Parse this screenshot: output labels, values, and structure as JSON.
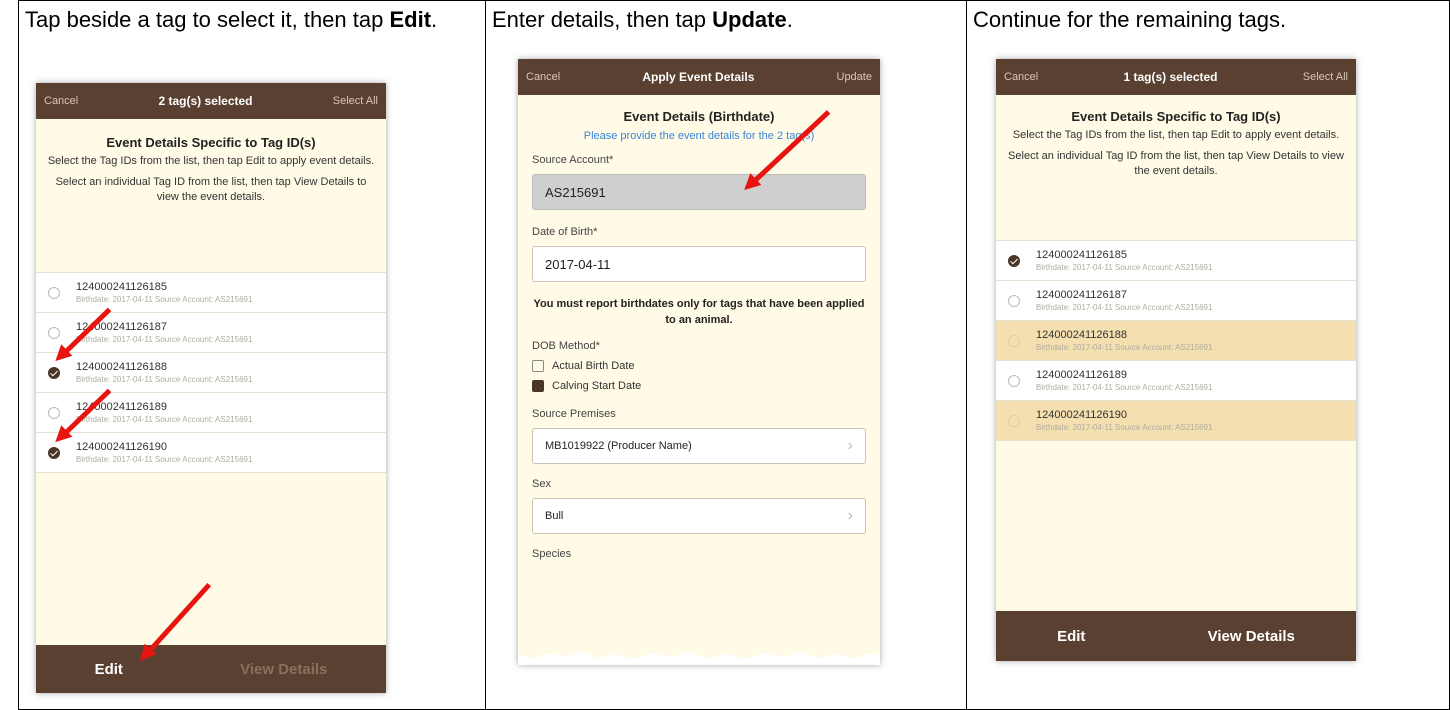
{
  "steps": [
    {
      "caption_pre": "Tap beside a tag to select it, then tap ",
      "caption_bold": "Edit",
      "caption_post": ".",
      "screen": {
        "cancel": "Cancel",
        "title": "2 tag(s) selected",
        "select_all": "Select All",
        "heading": "Event Details Specific to Tag ID(s)",
        "instruction1": "Select the Tag IDs from the list, then tap Edit to apply event details.",
        "instruction2": "Select an individual Tag ID from the list, then tap View Details to view the event details.",
        "tags": [
          {
            "id": "124000241126185",
            "detail": "Birthdate: 2017-04-11 Source Account: AS215691",
            "selected": false
          },
          {
            "id": "124000241126187",
            "detail": "Birthdate: 2017-04-11 Source Account: AS215691",
            "selected": false
          },
          {
            "id": "124000241126188",
            "detail": "Birthdate: 2017-04-11 Source Account: AS215691",
            "selected": true
          },
          {
            "id": "124000241126189",
            "detail": "Birthdate: 2017-04-11 Source Account: AS215691",
            "selected": false
          },
          {
            "id": "124000241126190",
            "detail": "Birthdate: 2017-04-11 Source Account: AS215691",
            "selected": true
          }
        ],
        "edit": "Edit",
        "view_details": "View Details"
      }
    },
    {
      "caption_pre": "Enter details, then tap ",
      "caption_bold": "Update",
      "caption_post": ".",
      "screen": {
        "cancel": "Cancel",
        "title": "Apply Event Details",
        "update": "Update",
        "heading": "Event Details (Birthdate)",
        "info": "Please provide the event details for the 2 tag(s)",
        "source_account_label": "Source Account*",
        "source_account_value": "AS215691",
        "dob_label": "Date of Birth*",
        "dob_value": "2017-04-11",
        "warning": "You must report birthdates only for tags that have been applied to an animal.",
        "dob_method_label": "DOB Method*",
        "dob_options": [
          {
            "label": "Actual Birth Date",
            "checked": false
          },
          {
            "label": "Calving Start Date",
            "checked": true
          }
        ],
        "premises_label": "Source Premises",
        "premises_value": "MB1019922 (Producer Name)",
        "sex_label": "Sex",
        "sex_value": "Bull",
        "species_label": "Species"
      }
    },
    {
      "caption_pre": "Continue for the remaining tags.",
      "caption_bold": "",
      "caption_post": "",
      "screen": {
        "cancel": "Cancel",
        "title": "1 tag(s) selected",
        "select_all": "Select All",
        "heading": "Event Details Specific to Tag ID(s)",
        "instruction1": "Select the Tag IDs from the list, then tap Edit to apply event details.",
        "instruction2": "Select an individual Tag ID from the list, then tap View Details to view the event details.",
        "tags": [
          {
            "id": "124000241126185",
            "detail": "Birthdate: 2017-04-11 Source Account: AS215691",
            "selected": true,
            "completed": false
          },
          {
            "id": "124000241126187",
            "detail": "Birthdate: 2017-04-11 Source Account: AS215691",
            "selected": false,
            "completed": false
          },
          {
            "id": "124000241126188",
            "detail": "Birthdate: 2017-04-11 Source Account: AS215691",
            "selected": false,
            "completed": true
          },
          {
            "id": "124000241126189",
            "detail": "Birthdate: 2017-04-11 Source Account: AS215691",
            "selected": false,
            "completed": false
          },
          {
            "id": "124000241126190",
            "detail": "Birthdate: 2017-04-11 Source Account: AS215691",
            "selected": false,
            "completed": true
          }
        ],
        "edit": "Edit",
        "view_details": "View Details"
      }
    }
  ],
  "colors": {
    "bar": "#5a4030",
    "screen_bg": "#fffbe7",
    "highlight_row": "#f4dfb0",
    "arrow": "#e8140f",
    "link": "#3a84d6"
  }
}
